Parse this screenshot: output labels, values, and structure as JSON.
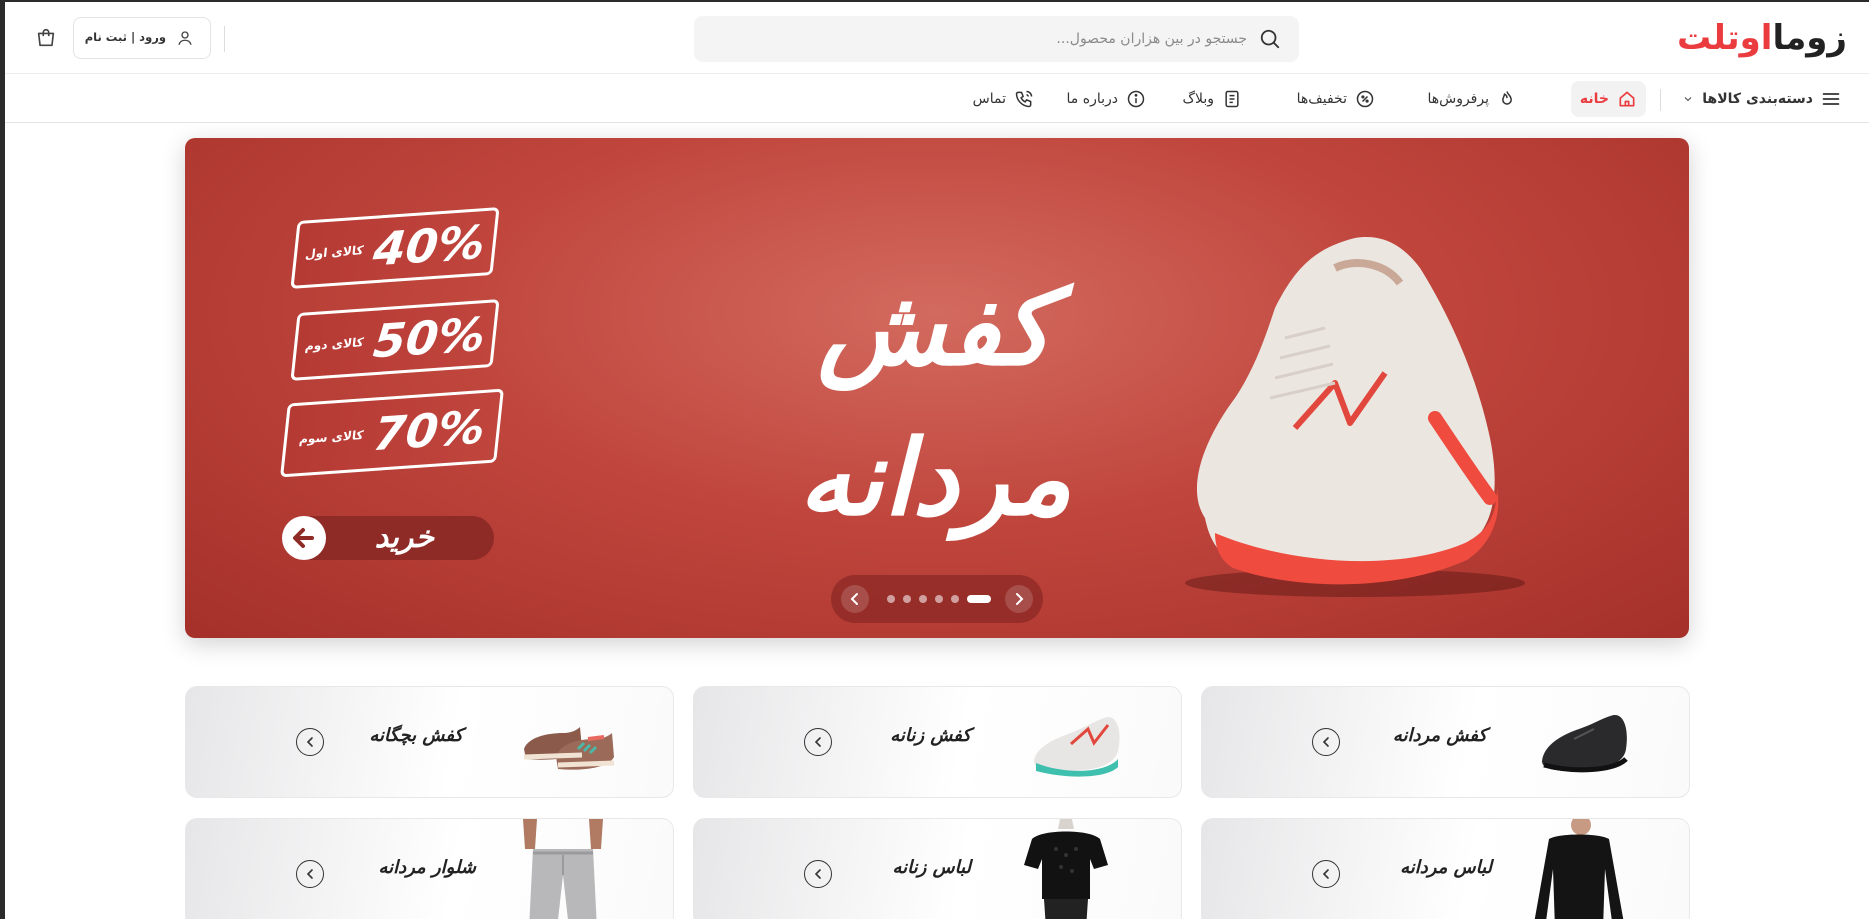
{
  "brand": {
    "logo_part1": "اوتلت",
    "logo_part2": "زوما"
  },
  "header": {
    "search_placeholder": "جستجو در بین هزاران محصول...",
    "login_label": "ورود | ثبت نام"
  },
  "nav": {
    "categories_label": "دسته‌بندی کالاها",
    "items": [
      {
        "label": "خانه",
        "icon": "home-icon",
        "active": true
      },
      {
        "label": "پرفروش‌ها",
        "icon": "fire-icon",
        "active": false
      },
      {
        "label": "تخفیف‌ها",
        "icon": "discount-icon",
        "active": false
      },
      {
        "label": "وبلاگ",
        "icon": "blog-icon",
        "active": false
      },
      {
        "label": "درباره ما",
        "icon": "info-icon",
        "active": false
      },
      {
        "label": "تماس",
        "icon": "phone-icon",
        "active": false
      }
    ]
  },
  "hero": {
    "title_line1": "کفش",
    "title_line2": "مردانه",
    "promos": [
      {
        "percent": "40%",
        "label": "کالای اول"
      },
      {
        "percent": "50%",
        "label": "کالای دوم"
      },
      {
        "percent": "70%",
        "label": "کالای سوم"
      }
    ],
    "buy_label": "خرید",
    "slide_count": 6,
    "active_slide": 1
  },
  "categories": [
    {
      "label": "کفش مردانه",
      "icon": "mens-shoe"
    },
    {
      "label": "کفش زنانه",
      "icon": "womens-shoe"
    },
    {
      "label": "کفش بچگانه",
      "icon": "kids-shoe"
    },
    {
      "label": "لباس مردانه",
      "icon": "mens-shirt"
    },
    {
      "label": "لباس زنانه",
      "icon": "womens-shirt"
    },
    {
      "label": "شلوار مردانه",
      "icon": "mens-pants"
    }
  ],
  "colors": {
    "accent": "#ea3b3f",
    "banner": "#c0463d"
  }
}
